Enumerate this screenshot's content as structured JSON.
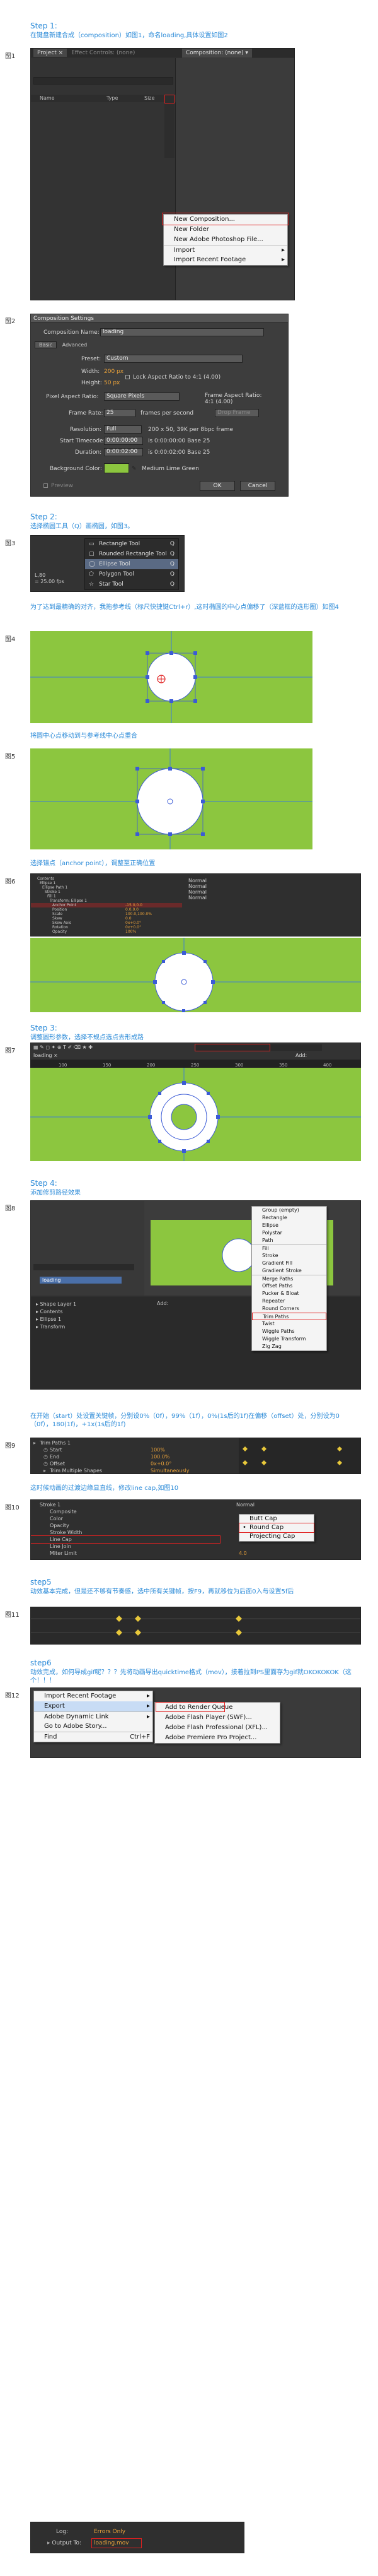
{
  "step1": {
    "title": "Step 1:",
    "desc": "在键盘新建合成（composition）如图1，命名loading,具体设置如图2"
  },
  "fig1": {
    "label": "图1",
    "tabs": [
      "Project ×",
      "Effect Controls: (none)",
      "Composition: (none) ▾"
    ],
    "columns": [
      "Name",
      "Type",
      "Size"
    ],
    "menu": [
      {
        "label": "New Composition...",
        "hl": true
      },
      {
        "label": "New Folder"
      },
      {
        "label": "New Adobe Photoshop File..."
      },
      {
        "label": "Import",
        "arrow": "▸",
        "sep": true
      },
      {
        "label": "Import Recent Footage",
        "arrow": "▸"
      }
    ]
  },
  "fig2": {
    "label": "图2",
    "title": "Composition Settings",
    "name_label": "Composition Name:",
    "name_value": "loading",
    "tabs": [
      "Basic",
      "Advanced"
    ],
    "preset_label": "Preset:",
    "preset_value": "Custom",
    "width_label": "Width:",
    "width_value": "200 px",
    "height_label": "Height:",
    "height_value": "50 px",
    "lock_label": "Lock Aspect Ratio to 4:1 (4.00)",
    "par_label": "Pixel Aspect Ratio:",
    "par_value": "Square Pixels",
    "far_label": "Frame Aspect Ratio:",
    "far_value": "4:1 (4.00)",
    "fps_label": "Frame Rate:",
    "fps_value": "25",
    "fps_unit": "frames per second",
    "drop_frame": "Drop Frame",
    "res_label": "Resolution:",
    "res_value": "Full",
    "res_info": "200 x 50, 39K per 8bpc frame",
    "start_label": "Start Timecode:",
    "start_value": "0:00:00:00",
    "start_info": "is 0:00:00:00  Base 25",
    "dur_label": "Duration:",
    "dur_value": "0:00:02:00",
    "dur_info": "is 0:00:02:00  Base 25",
    "bg_label": "Background Color:",
    "bg_name": "Medium Lime Green",
    "bg_color": "#8cc63f",
    "preview": "Preview",
    "ok": "OK",
    "cancel": "Cancel"
  },
  "step2": {
    "title": "Step 2:",
    "desc": "选择椭圆工具（Q）画椭圆，如图3。"
  },
  "fig3": {
    "label": "图3",
    "left_vals": [
      "L,80",
      "= 25.00 fps"
    ],
    "tools": [
      {
        "label": "Rectangle Tool",
        "key": "Q"
      },
      {
        "label": "Rounded Rectangle Tool",
        "key": "Q"
      },
      {
        "label": "Ellipse Tool",
        "key": "Q",
        "hl": true
      },
      {
        "label": "Polygon Tool",
        "key": "Q"
      },
      {
        "label": "Star Tool",
        "key": "Q"
      }
    ]
  },
  "desc4": "为了达到最精确的对齐，我拖参考线（标尺快捷键Ctrl+r）,这时椭圆的中心点偏移了（深蓝框的选形圈）如图4",
  "fig4": {
    "label": "图4"
  },
  "desc5": "将圆中心点移动到与参考线中心点重合",
  "fig5": {
    "label": "图5"
  },
  "desc6": "选择锚点（anchor point），调整至正确位置",
  "fig6": {
    "label": "图6",
    "rows": [
      {
        "t": "Contents",
        "c": ""
      },
      {
        "t": "Ellipse 1",
        "c": ""
      },
      {
        "t": "Ellipse Path 1",
        "c": ""
      },
      {
        "t": "Stroke 1",
        "c": ""
      },
      {
        "t": "Fill 1",
        "c": ""
      },
      {
        "t": "Transform: Ellipse 1",
        "c": ""
      },
      {
        "t": "Anchor Point",
        "c": "-15.0,0.0",
        "hl": true
      },
      {
        "t": "Position",
        "c": "0.0,0.0"
      },
      {
        "t": "Scale",
        "c": "100.0,100.0%"
      },
      {
        "t": "Skew",
        "c": "0.0"
      },
      {
        "t": "Skew Axis",
        "c": "0x+0.0°"
      },
      {
        "t": "Rotation",
        "c": "0x+0.0°"
      },
      {
        "t": "Opacity",
        "c": "100%"
      }
    ],
    "modes": [
      "Normal",
      "Normal",
      "Normal",
      "Normal"
    ]
  },
  "step3": {
    "title": "Step 3:",
    "desc": "调整圆形参数，选择不规点选点去形成路"
  },
  "fig7": {
    "label": "图7",
    "tab": "loading ×",
    "ruler": [
      "100",
      "150",
      "200",
      "250",
      "300",
      "350",
      "400"
    ],
    "zoom": "Add:"
  },
  "step4": {
    "title": "Step 4:",
    "desc": "添加修剪路径效果"
  },
  "fig8": {
    "label": "图8",
    "menu": [
      "Group (empty)",
      "Rectangle",
      "Ellipse",
      "Polystar",
      "Path",
      "Fill",
      "Stroke",
      "Gradient Fill",
      "Gradient Stroke",
      "Merge Paths",
      "Offset Paths",
      "Pucker & Bloat",
      "Repeater",
      "Round Corners",
      "Trim Paths",
      "Twist",
      "Wiggle Paths",
      "Wiggle Transform",
      "Zig Zag"
    ],
    "selected": "Trim Paths",
    "layer": "loading",
    "add": "Add:"
  },
  "desc9": "在开始（start）处设置关键帧，分别设0%（0f），99%（1f），0%(1s后的1f)在偏移（offset）处，分别设为0（0f），180(1f)，+1x(1s后的1f)",
  "fig9": {
    "label": "图9",
    "rows": [
      {
        "t": "Trim Paths 1",
        "c": ""
      },
      {
        "t": "Start",
        "c": "100%"
      },
      {
        "t": "End",
        "c": "100.0%"
      },
      {
        "t": "Offset",
        "c": "0x+0.0°"
      },
      {
        "t": "Trim Multiple Shapes",
        "c": "Simultaneously"
      }
    ]
  },
  "desc10": "这时候动画的过渡边缘显直线，修改line cap,如图10",
  "fig10": {
    "label": "图10",
    "rows": [
      "Stroke 1",
      "Composite",
      "Color",
      "Opacity",
      "Stroke Width",
      "Line Cap",
      "Line Join",
      "Miter Limit"
    ],
    "hl_row": "Line Cap",
    "mode": "Normal",
    "miter": "4.0",
    "menu": [
      "Butt Cap",
      "Round Cap",
      "Projecting Cap"
    ],
    "selected": "Round Cap"
  },
  "step5": {
    "title": "step5",
    "desc": "动效基本完成，但是还不够有节奏感，选中所有关键帧，按F9，再就移位为后面0入与设置5f后"
  },
  "fig11": {
    "label": "图11"
  },
  "step6": {
    "title": "step6",
    "desc": "动效完成，如何导成gif呢？？？先将动画导出quicktime格式（mov），接着拉到PS里面存为gif就OKOKOKOK（这个！！！"
  },
  "fig12": {
    "label": "图12",
    "menu_left": [
      {
        "label": "Import Recent Footage",
        "arrow": "▸"
      },
      {
        "label": "Export",
        "arrow": "▸",
        "hl": true
      },
      {
        "label": "Adobe Dynamic Link",
        "arrow": "▸",
        "sep": true
      },
      {
        "label": "Go to Adobe Story..."
      },
      {
        "label": "Find",
        "key": "Ctrl+F",
        "sep": true
      }
    ],
    "menu_right": [
      {
        "label": "Add to Render Queue",
        "boxed": true
      },
      {
        "label": "Adobe Flash Player (SWF)..."
      },
      {
        "label": "Adobe Flash Professional (XFL)..."
      },
      {
        "label": "Adobe Premiere Pro Project..."
      }
    ]
  },
  "fig13": {
    "rows": [
      {
        "t": "Log:",
        "c": "Errors Only"
      },
      {
        "t": "Output To:",
        "c": "loading.mov"
      }
    ]
  }
}
